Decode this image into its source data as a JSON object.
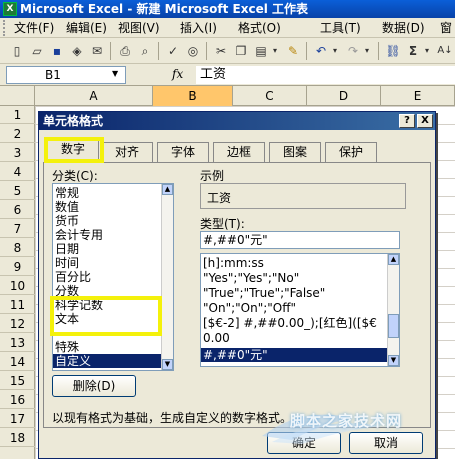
{
  "window": {
    "title": "Microsoft Excel - 新建 Microsoft Excel 工作表"
  },
  "menubar": {
    "items": [
      {
        "label": "文件(F)"
      },
      {
        "label": "编辑(E)"
      },
      {
        "label": "视图(V)"
      },
      {
        "label": "插入(I)"
      },
      {
        "label": "格式(O)"
      },
      {
        "label": "工具(T)"
      },
      {
        "label": "数据(D)"
      },
      {
        "label": "窗"
      }
    ]
  },
  "formula_bar": {
    "name_box": "B1",
    "fx": "fx",
    "content": "工资"
  },
  "columns": [
    "A",
    "B",
    "C",
    "D",
    "E"
  ],
  "rows": [
    "1",
    "2",
    "3",
    "4",
    "5",
    "6",
    "7",
    "8",
    "9",
    "10",
    "11",
    "12",
    "13",
    "14",
    "15",
    "16",
    "17",
    "18"
  ],
  "dialog": {
    "title": "单元格格式",
    "help_button": "?",
    "close_button": "X",
    "tabs": [
      "数字",
      "对齐",
      "字体",
      "边框",
      "图案",
      "保护"
    ],
    "active_tab": "数字",
    "category_label": "分类(C):",
    "categories": [
      "常规",
      "数值",
      "货币",
      "会计专用",
      "日期",
      "时间",
      "百分比",
      "分数",
      "科学记数",
      "文本",
      "特殊",
      "自定义"
    ],
    "selected_category": "自定义",
    "sample_label": "示例",
    "sample_value": "工资",
    "type_label": "类型(T):",
    "type_value": "#,##0\"元\"",
    "type_list": [
      "[h]:mm:ss",
      "\"Yes\";\"Yes\";\"No\"",
      "\"True\";\"True\";\"False\"",
      "\"On\";\"On\";\"Off\"",
      "[$€-2] #,##0.00_);[红色]([$€",
      "0.00",
      "#,##0\"元\""
    ],
    "selected_type": "#,##0\"元\"",
    "delete_button": "删除(D)",
    "description": "以现有格式为基础，生成自定义的数字格式。",
    "ok_button": "确定",
    "cancel_button": "取消"
  },
  "watermark": {
    "text": "脚本之家技术网"
  },
  "colors": {
    "highlight": "#f4f10b",
    "selection": "#0a246a",
    "title_bar": "#0a5fd8"
  }
}
